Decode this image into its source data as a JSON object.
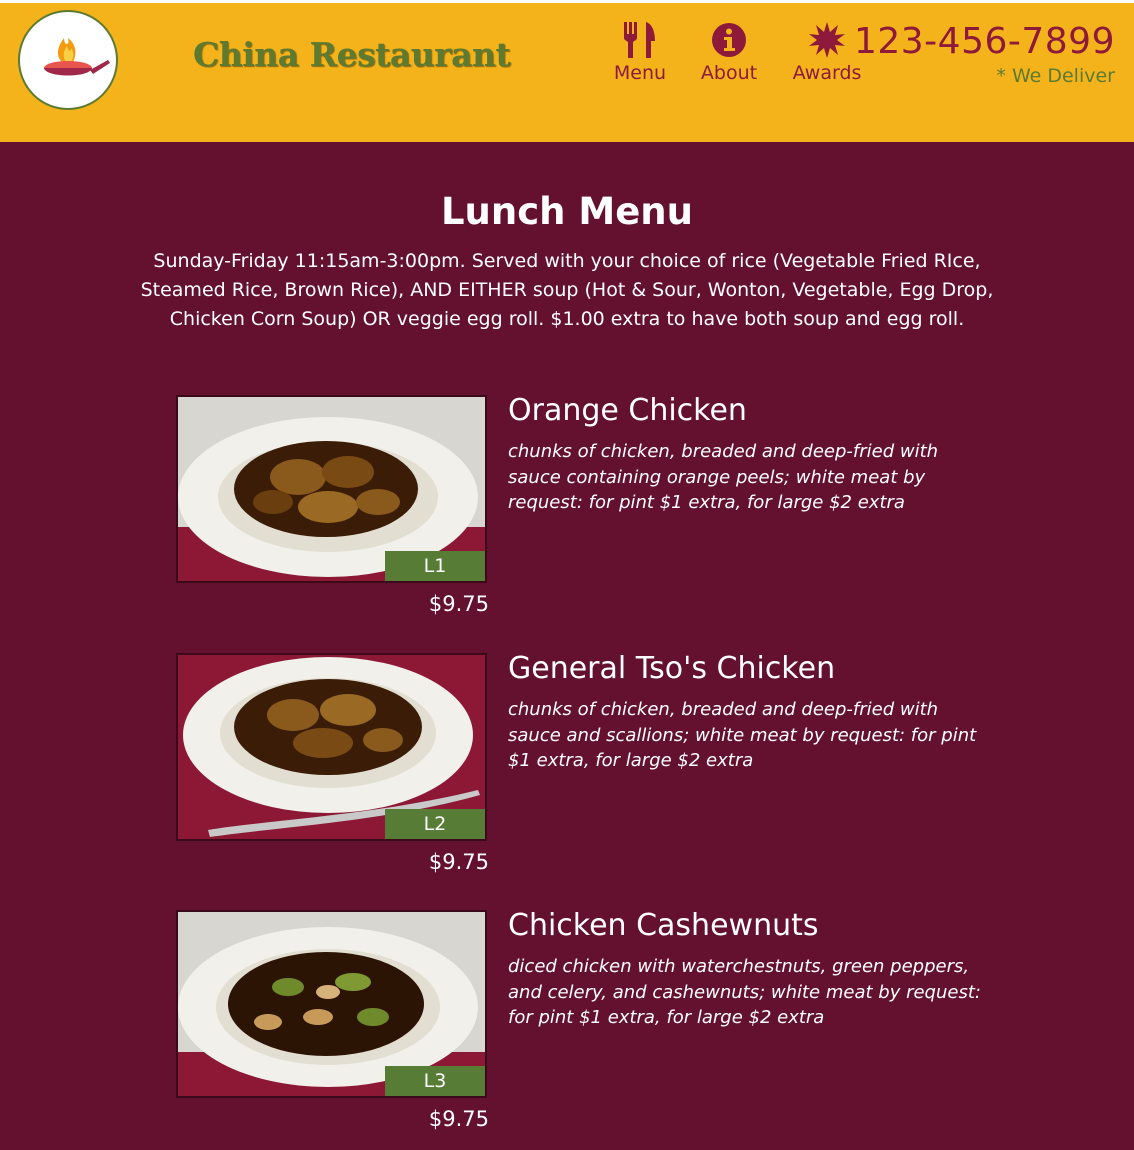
{
  "header": {
    "brand": "China Restaurant",
    "nav": [
      {
        "label": "Menu",
        "icon": "utensils-icon"
      },
      {
        "label": "About",
        "icon": "info-icon"
      },
      {
        "label": "Awards",
        "icon": "starburst-icon"
      }
    ],
    "phone": "123-456-7899",
    "deliver": "* We Deliver",
    "colors": {
      "bar": "#f4b31b",
      "accent": "#8e1a3b",
      "green": "#5d7a30"
    }
  },
  "page": {
    "title": "Lunch Menu",
    "intro": "Sunday-Friday 11:15am-3:00pm. Served with your choice of rice (Vegetable Fried RIce, Steamed Rice, Brown Rice), AND EITHER soup (Hot & Sour, Wonton, Vegetable, Egg Drop, Chicken Corn Soup) OR veggie egg roll. $1.00 extra to have both soup and egg roll.",
    "background": "#63112e"
  },
  "items": [
    {
      "code": "L1",
      "name": "Orange Chicken",
      "description": "chunks of chicken, breaded and deep-fried with sauce containing orange peels; white meat by request: for pint $1 extra, for large $2 extra",
      "price": "$9.75"
    },
    {
      "code": "L2",
      "name": "General Tso's Chicken",
      "description": "chunks of chicken, breaded and deep-fried with sauce and scallions; white meat by request: for pint $1 extra, for large $2 extra",
      "price": "$9.75"
    },
    {
      "code": "L3",
      "name": "Chicken Cashewnuts",
      "description": "diced chicken with waterchestnuts, green peppers, and celery, and cashewnuts; white meat by request: for pint $1 extra, for large $2 extra",
      "price": "$9.75"
    }
  ]
}
